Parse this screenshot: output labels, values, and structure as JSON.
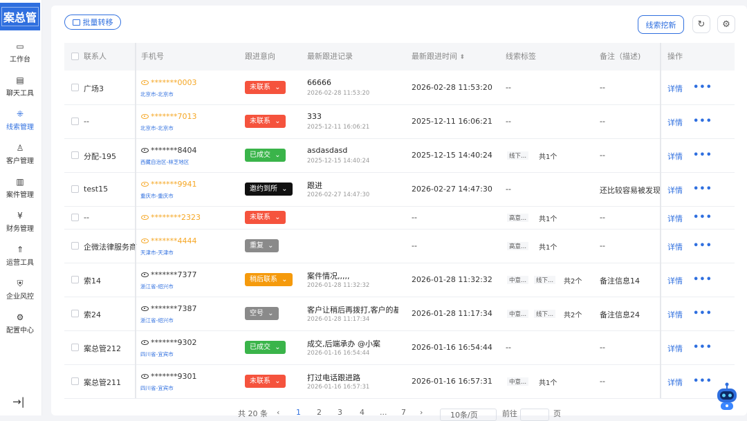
{
  "sidebar": {
    "logo": "案总管",
    "items": [
      {
        "label": "工作台",
        "icon": "monitor-icon",
        "active": false
      },
      {
        "label": "聊天工具",
        "icon": "chat-icon",
        "active": false
      },
      {
        "label": "线索管理",
        "icon": "lead-icon",
        "active": true
      },
      {
        "label": "客户管理",
        "icon": "user-icon",
        "active": false
      },
      {
        "label": "案件管理",
        "icon": "case-icon",
        "active": false
      },
      {
        "label": "财务管理",
        "icon": "finance-icon",
        "active": false
      },
      {
        "label": "运营工具",
        "icon": "rocket-icon",
        "active": false
      },
      {
        "label": "企业风控",
        "icon": "shield-icon",
        "active": false
      },
      {
        "label": "配置中心",
        "icon": "gear-icon",
        "active": false
      }
    ],
    "collapse_icon": "→|"
  },
  "toolbar": {
    "batch_transfer": "批量转移",
    "lead_mining": "线索挖新",
    "refresh_icon": "↻",
    "settings_icon": "⚙"
  },
  "table": {
    "headers": {
      "contact": "联系人",
      "phone": "手机号",
      "intent": "跟进意向",
      "latest_record": "最新跟进记录",
      "latest_time": "最新跟进时间",
      "tags": "线索标签",
      "note": "备注（描述)",
      "ops": "操作"
    },
    "detail_label": "详情",
    "more_label": "•••",
    "rows": [
      {
        "contact": "广场3",
        "phone": "*******0003",
        "masked": true,
        "region": "北京市-北京市",
        "status": "未联系",
        "status_color": "#f5533d",
        "record": "66666",
        "record_time": "2026-02-28 11:53:20",
        "time": "2026-02-28 11:53:20",
        "tags": [],
        "tag_text": "--",
        "tag_count": "",
        "note": "--"
      },
      {
        "contact": "--",
        "phone": "*******7013",
        "masked": true,
        "region": "北京市-北京市",
        "status": "未联系",
        "status_color": "#f5533d",
        "record": "333",
        "record_time": "2025-12-11 16:06:21",
        "time": "2025-12-11 16:06:21",
        "tags": [],
        "tag_text": "--",
        "tag_count": "",
        "note": "--"
      },
      {
        "contact": "分配-195",
        "phone": "*******8404",
        "masked": false,
        "region": "西藏自治区-林芝地区",
        "status": "已成交",
        "status_color": "#3ab44a",
        "record": "asdasdasd",
        "record_time": "2025-12-15 14:40:24",
        "time": "2025-12-15 14:40:24",
        "tags": [
          "线下..."
        ],
        "tag_text": "",
        "tag_count": "共1个",
        "note": "--"
      },
      {
        "contact": "test15",
        "phone": "*******9941",
        "masked": true,
        "region": "重庆市-重庆市",
        "status": "邀约到所",
        "status_color": "#111111",
        "record": "跟进",
        "record_time": "2026-02-27 14:47:30",
        "time": "2026-02-27 14:47:30",
        "tags": [],
        "tag_text": "--",
        "tag_count": "",
        "note": "还比较容易被发现和"
      },
      {
        "contact": "--",
        "phone": "********2323",
        "masked": true,
        "region": "",
        "status": "未联系",
        "status_color": "#f5533d",
        "record": "",
        "record_time": "",
        "time": "--",
        "tags": [
          "高意..."
        ],
        "tag_text": "",
        "tag_count": "共1个",
        "note": "--"
      },
      {
        "contact": "企微法律服务商",
        "phone": "*******4444",
        "masked": true,
        "region": "天津市-天津市",
        "status": "重复",
        "status_color": "#8a8a8a",
        "record": "",
        "record_time": "",
        "time": "--",
        "tags": [
          "高意..."
        ],
        "tag_text": "",
        "tag_count": "共1个",
        "note": "--"
      },
      {
        "contact": "索14",
        "phone": "*******7377",
        "masked": false,
        "region": "浙江省-绍兴市",
        "status": "稍后联系",
        "status_color": "#f59a0c",
        "record": "案件情况,,,,,",
        "record_time": "2026-01-28 11:32:32",
        "time": "2026-01-28 11:32:32",
        "tags": [
          "中意...",
          "线下..."
        ],
        "tag_text": "",
        "tag_count": "共2个",
        "note": "备注信息14"
      },
      {
        "contact": "索24",
        "phone": "*******7387",
        "masked": false,
        "region": "浙江省-绍兴市",
        "status": "空号",
        "status_color": "#8a8a8a",
        "record": "客户让稍后再拨打,客户的基本",
        "record_time": "2026-01-28 11:17:34",
        "time": "2026-01-28 11:17:34",
        "tags": [
          "中意...",
          "线下..."
        ],
        "tag_text": "",
        "tag_count": "共2个",
        "note": "备注信息24"
      },
      {
        "contact": "案总管212",
        "phone": "*******9302",
        "masked": false,
        "region": "四川省-宜宾市",
        "status": "已成交",
        "status_color": "#3ab44a",
        "record": "成交,后端承办 @小案",
        "record_time": "2026-01-16 16:54:44",
        "time": "2026-01-16 16:54:44",
        "tags": [],
        "tag_text": "--",
        "tag_count": "",
        "note": "--"
      },
      {
        "contact": "案总管211",
        "phone": "*******9301",
        "masked": false,
        "region": "四川省-宜宾市",
        "status": "未联系",
        "status_color": "#f5533d",
        "record": "打过电话跟进路",
        "record_time": "2026-01-16 16:57:31",
        "time": "2026-01-16 16:57:31",
        "tags": [
          "中意..."
        ],
        "tag_text": "",
        "tag_count": "共1个",
        "note": "--"
      }
    ]
  },
  "pager": {
    "total": "共 20 条",
    "pages": [
      "1",
      "2",
      "3",
      "4",
      "...",
      "7"
    ],
    "page_size": "10条/页",
    "goto_label": "前往",
    "goto_unit": "页"
  }
}
